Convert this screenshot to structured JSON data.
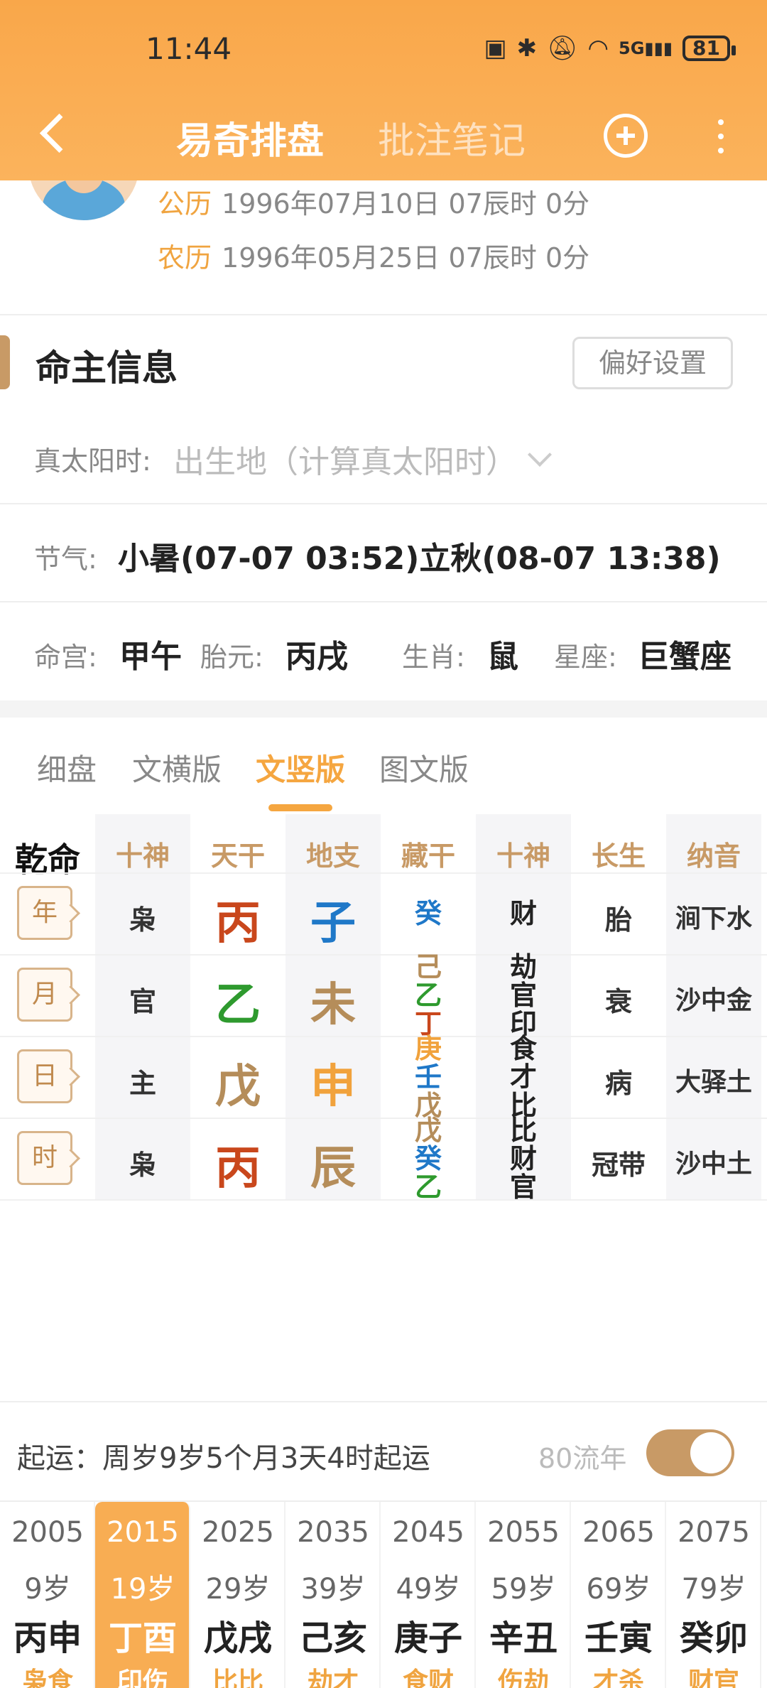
{
  "status_bar": {
    "time": "11:44",
    "battery": "81",
    "network": "5G"
  },
  "nav": {
    "title_active": "易奇排盘",
    "title_inactive": "批注笔记"
  },
  "profile": {
    "solar_label": "公历",
    "solar_value": "1996年07月10日 07辰时 0分",
    "lunar_label": "农历",
    "lunar_value": "1996年05月25日 07辰时 0分"
  },
  "section": {
    "title": "命主信息",
    "pref_button": "偏好设置"
  },
  "info": {
    "true_solar_label": "真太阳时:",
    "true_solar_placeholder": "出生地（计算真太阳时）",
    "jieqi_label": "节气:",
    "jieqi_value": "小暑(07-07 03:52)立秋(08-07 13:38)",
    "minggong_label": "命宫:",
    "minggong_value": "甲午",
    "taiyuan_label": "胎元:",
    "taiyuan_value": "丙戌",
    "shengxiao_label": "生肖:",
    "shengxiao_value": "鼠",
    "xingzuo_label": "星座:",
    "xingzuo_value": "巨蟹座"
  },
  "subtabs": [
    "细盘",
    "文横版",
    "文竖版",
    "图文版"
  ],
  "subtab_active": "文竖版",
  "table": {
    "corner": "乾命",
    "headers": [
      "十神",
      "天干",
      "地支",
      "藏干",
      "十神",
      "长生",
      "纳音"
    ],
    "rows": [
      {
        "pillar": "年",
        "shishen": "枭",
        "gan": "丙",
        "zhi": "子",
        "canggan": [
          "癸"
        ],
        "zhi_shishen": [
          "财"
        ],
        "changsheng": "胎",
        "nayin": "涧下水"
      },
      {
        "pillar": "月",
        "shishen": "官",
        "gan": "乙",
        "zhi": "未",
        "canggan": [
          "己",
          "乙",
          "丁"
        ],
        "zhi_shishen": [
          "劫",
          "官",
          "印"
        ],
        "changsheng": "衰",
        "nayin": "沙中金"
      },
      {
        "pillar": "日",
        "shishen": "主",
        "gan": "戊",
        "zhi": "申",
        "canggan": [
          "庚",
          "壬",
          "戊"
        ],
        "zhi_shishen": [
          "食",
          "才",
          "比"
        ],
        "changsheng": "病",
        "nayin": "大驿土"
      },
      {
        "pillar": "时",
        "shishen": "枭",
        "gan": "丙",
        "zhi": "辰",
        "canggan": [
          "戊",
          "癸",
          "乙"
        ],
        "zhi_shishen": [
          "比",
          "财",
          "官"
        ],
        "changsheng": "冠带",
        "nayin": "沙中土"
      }
    ],
    "colors": {
      "fire": "#c9471c",
      "water": "#1f78c8",
      "wood": "#2e9a2e",
      "earth": "#b58d5a",
      "metal": "#f1a23c"
    }
  },
  "qiyun": {
    "text": "起运：周岁9岁5个月3天4时起运",
    "liunian_label": "80流年",
    "toggle_on": true
  },
  "dayun": [
    {
      "year": "2005",
      "age": "9岁",
      "ganzhi": "丙申",
      "shishen": "枭食"
    },
    {
      "year": "2015",
      "age": "19岁",
      "ganzhi": "丁酉",
      "shishen": "印伤"
    },
    {
      "year": "2025",
      "age": "29岁",
      "ganzhi": "戊戌",
      "shishen": "比比"
    },
    {
      "year": "2035",
      "age": "39岁",
      "ganzhi": "己亥",
      "shishen": "劫才"
    },
    {
      "year": "2045",
      "age": "49岁",
      "ganzhi": "庚子",
      "shishen": "食财"
    },
    {
      "year": "2055",
      "age": "59岁",
      "ganzhi": "辛丑",
      "shishen": "伤劫"
    },
    {
      "year": "2065",
      "age": "69岁",
      "ganzhi": "壬寅",
      "shishen": "才杀"
    },
    {
      "year": "2075",
      "age": "79岁",
      "ganzhi": "癸卯",
      "shishen": "财官"
    }
  ],
  "dayun_selected": 1
}
